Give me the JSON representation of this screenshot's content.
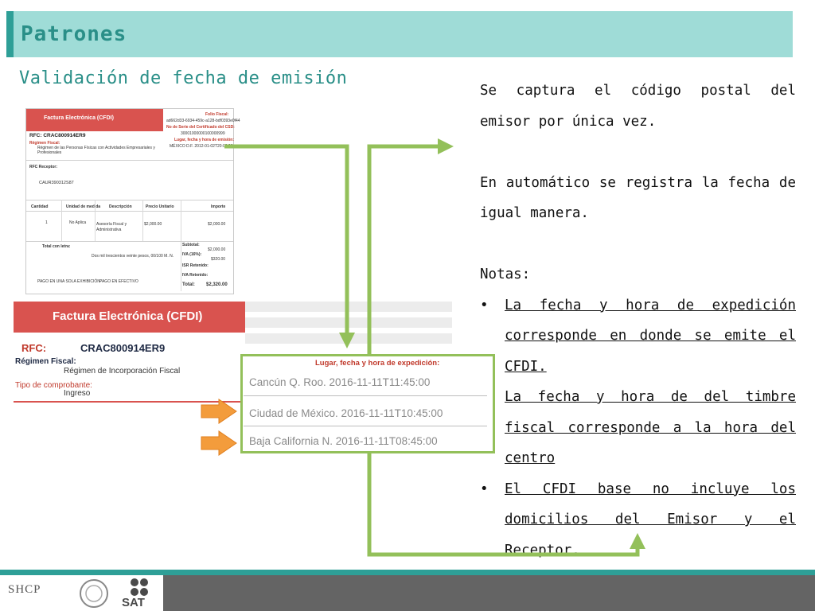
{
  "header": {
    "title": "Patrones",
    "subtitle": "Validación de fecha de emisión",
    "colors": {
      "band": "#9fdcd7",
      "accent": "#2e9f97",
      "title_text": "#2a8f88"
    }
  },
  "right_text": {
    "para1": "Se captura el código postal del emisor por única vez.",
    "para2": "En automático se registra la fecha de igual manera.",
    "notes_label": "Notas:",
    "bullet_char": "•",
    "bullets": [
      "La fecha y hora de expedición corresponde en donde se emite el CFDI.",
      "La fecha y hora de del timbre fiscal corresponde a la hora del centro",
      "El CFDI base no incluye los domicilios del Emisor y el Receptor."
    ]
  },
  "small_invoice": {
    "title": "Factura Electrónica (CFDI)",
    "folio_label": "Folio Fiscal:",
    "folio_value": "ad662d33-6934-459c-a128-bdf0393e0f44",
    "serie_label": "No de Serie del Certificado del CSD:",
    "serie_value": "30001000000100000999",
    "lugar_label": "Lugar, fecha y hora de emisión:",
    "lugar_value": "MÉXICO D.F. 2012-01-02T20:00:00",
    "rfc": "RFC:  CRAC800914ER9",
    "regimen_label": "Régimen Fiscal:",
    "regimen_value": "Régimen de las Personas Físicas con Actividades Empresariales y Profesionales",
    "receptor_label": "RFC Receptor:",
    "receptor_value": "CAUR390312S87",
    "columns": [
      "Cantidad",
      "Unidad de medida",
      "Descripción",
      "Precio Unitario",
      "Importe"
    ],
    "row": {
      "cantidad": "1",
      "unidad": "No Aplica",
      "descripcion": "Asesoría Fiscal y Administrativa",
      "precio": "$2,000.00",
      "importe": "$2,000.00"
    },
    "total_letra_label": "Total con letra:",
    "total_letra_value": "Dos mil trescientos veinte pesos, 00/100 M. N.",
    "subtotal_label": "Subtotal:",
    "subtotal_value": "$2,000.00",
    "iva_label": "IVA (16%):",
    "iva_value": "$320.00",
    "isr_label": "ISR Retenido:",
    "iva_ret_label": "IVA Retenido:",
    "total_label": "Total:",
    "total_value": "$2,320.00",
    "pago1": "PAGO EN UNA SOLA EXHIBICIÓN",
    "pago2": "PAGO EN EFECTIVO"
  },
  "big_invoice": {
    "title": "Factura Electrónica (CFDI)",
    "rfc_label": "RFC:",
    "rfc_value": "CRAC800914ER9",
    "regimen_label": "Régimen Fiscal:",
    "regimen_value": "Régimen de Incorporación Fiscal",
    "tipo_label": "Tipo de comprobante:",
    "tipo_value": "Ingreso"
  },
  "callout": {
    "title": "Lugar, fecha y hora de expedición:",
    "rows": [
      "Cancún Q. Roo. 2016-11-11T11:45:00",
      "Ciudad de México. 2016-11-11T10:45:00",
      "Baja California N. 2016-11-11T08:45:00"
    ],
    "colors": {
      "border": "#93c05a",
      "arrow_orange": "#f39c3c"
    }
  },
  "footer": {
    "shcp": "SHCP",
    "sat": "SAT"
  }
}
